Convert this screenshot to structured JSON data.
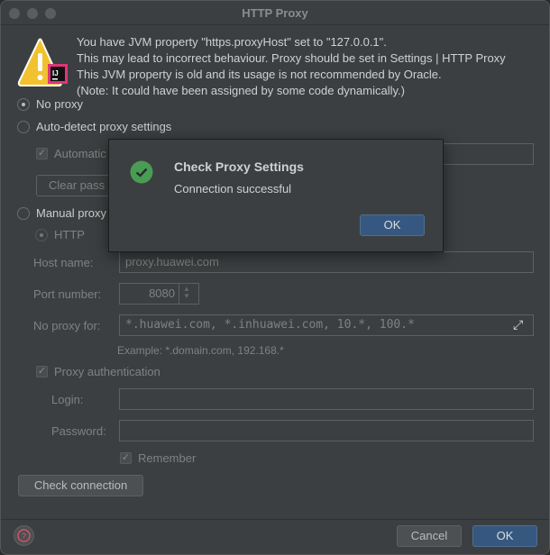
{
  "window": {
    "title": "HTTP Proxy"
  },
  "warning": {
    "lines": [
      "You have JVM property \"https.proxyHost\" set to \"127.0.0.1\".",
      "This may lead to incorrect behaviour. Proxy should be set in Settings | HTTP Proxy",
      "This JVM property is old and its usage is not recommended by Oracle.",
      "(Note: It could have been assigned by some code dynamically.)"
    ],
    "badge": "IJ"
  },
  "options": {
    "no_proxy": "No proxy",
    "auto_detect": "Auto-detect proxy settings",
    "automatic_partial": "Automatic",
    "clear_partial": "Clear pass",
    "manual_partial": "Manual proxy",
    "http": "HTTP",
    "selected": "No proxy"
  },
  "form": {
    "host_label": "Host name:",
    "host_value": "proxy.huawei.com",
    "port_label": "Port number:",
    "port_value": "8080",
    "noproxy_label": "No proxy for:",
    "noproxy_value": "*.huawei.com, *.inhuawei.com, 10.*, 100.*",
    "example": "Example: *.domain.com, 192.168.*",
    "auth_label": "Proxy authentication",
    "login_label": "Login:",
    "login_value": "",
    "password_label": "Password:",
    "password_value": "",
    "remember_label": "Remember"
  },
  "buttons": {
    "check": "Check connection",
    "cancel": "Cancel",
    "ok": "OK"
  },
  "popup": {
    "title": "Check Proxy Settings",
    "message": "Connection successful",
    "ok": "OK"
  },
  "colors": {
    "accent": "#365880",
    "success": "#499c54",
    "help": "#e0556b"
  }
}
